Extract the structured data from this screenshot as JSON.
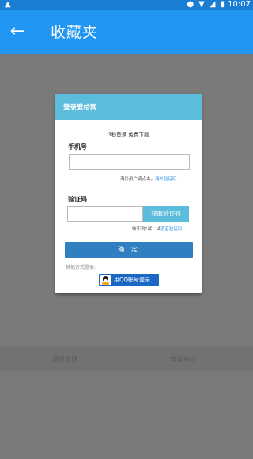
{
  "status_bar": {
    "time": "10:07",
    "left_icon": "warning-icon",
    "right_icons": [
      "location-icon",
      "wifi-icon",
      "signal-icon",
      "battery-icon"
    ]
  },
  "app_bar": {
    "back_icon": "←",
    "title": "收藏夹"
  },
  "login_dialog": {
    "header": "登录爱给网",
    "promo": "3秒登录 免费下载",
    "phone": {
      "label": "手机号",
      "value": "",
      "hint_prefix": "海外用户请点击，",
      "hint_link": "海外验证码"
    },
    "code": {
      "label": "验证码",
      "value": "",
      "button": "获取验证码",
      "hint_prefix": "收不到?试一试",
      "hint_link": "语音验证码"
    },
    "confirm_button": "确 定",
    "other_login_label": "其他方式登录:",
    "qq_button": "用QQ帐号登录"
  },
  "bottom_links": {
    "feedback": "意见反馈",
    "help": "帮助中心"
  },
  "colors": {
    "status_bar": "#1a7fd4",
    "app_bar": "#2196f3",
    "dialog_header": "#5bbcdb",
    "confirm_button": "#2f7fc1",
    "qq_button": "#1a67c4",
    "overlay": "#7a7a7a"
  }
}
